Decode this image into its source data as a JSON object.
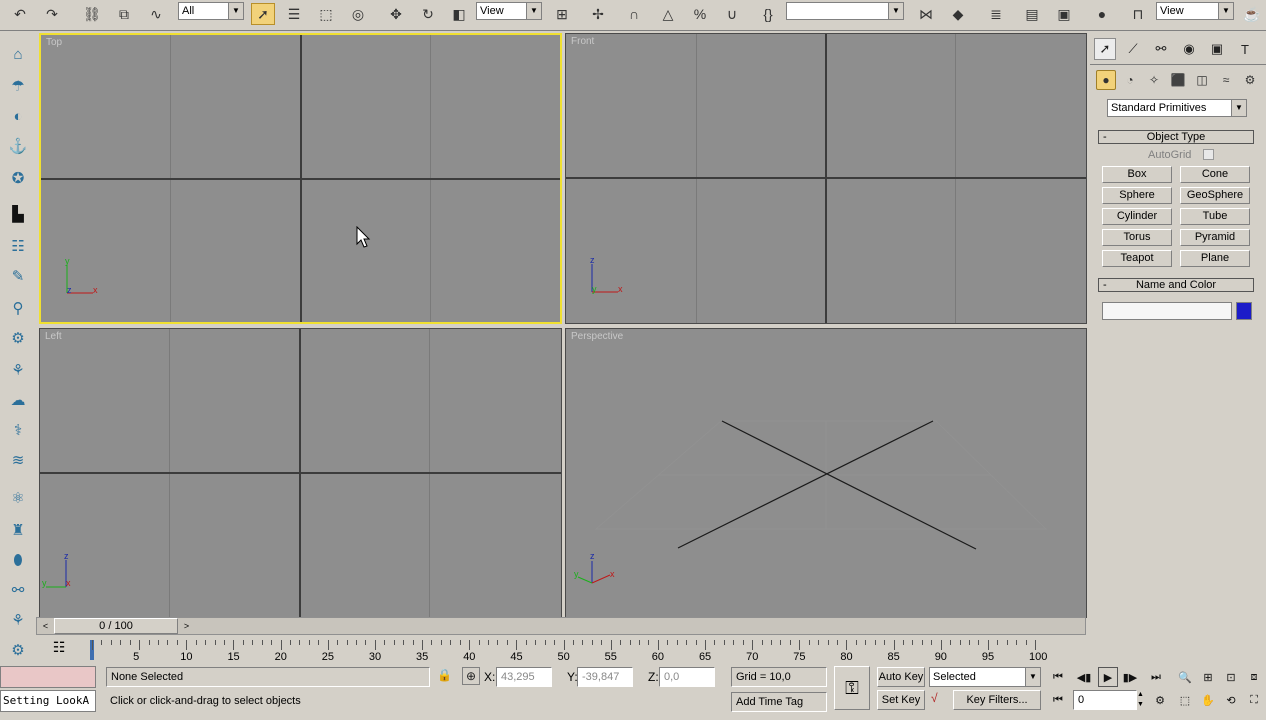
{
  "toolbar": {
    "filter": "All",
    "ref_coord": "View",
    "named_set": "",
    "view2": "View"
  },
  "viewports": {
    "top": "Top",
    "front": "Front",
    "left": "Left",
    "perspective": "Perspective"
  },
  "axes": {
    "x": "x",
    "y": "y",
    "z": "z"
  },
  "panel": {
    "category": "Standard Primitives",
    "object_type_title": "Object Type",
    "autogrid": "AutoGrid",
    "buttons": [
      "Box",
      "Cone",
      "Sphere",
      "GeoSphere",
      "Cylinder",
      "Tube",
      "Torus",
      "Pyramid",
      "Teapot",
      "Plane"
    ],
    "name_color_title": "Name and Color",
    "name_value": "",
    "color": "#1c1cc8"
  },
  "timeline": {
    "frame": "0 / 100",
    "ticks": [
      "5",
      "10",
      "15",
      "20",
      "25",
      "30",
      "35",
      "40",
      "45",
      "50",
      "55",
      "60",
      "65",
      "70",
      "75",
      "80",
      "85",
      "90",
      "95",
      "100"
    ]
  },
  "status": {
    "selection": "None Selected",
    "prompt": "Click or click-and-drag to select objects",
    "x_label": "X:",
    "x_value": "43,295",
    "y_label": "Y:",
    "y_value": "-39,847",
    "z_label": "Z:",
    "z_value": "0,0",
    "grid": "Grid = 10,0",
    "add_time_tag": "Add Time Tag",
    "auto_key": "Auto Key",
    "set_key": "Set Key",
    "key_mode": "Selected",
    "key_filters": "Key Filters...",
    "current_frame": "0",
    "maxscript": "Setting LookA",
    "minus": "-"
  }
}
